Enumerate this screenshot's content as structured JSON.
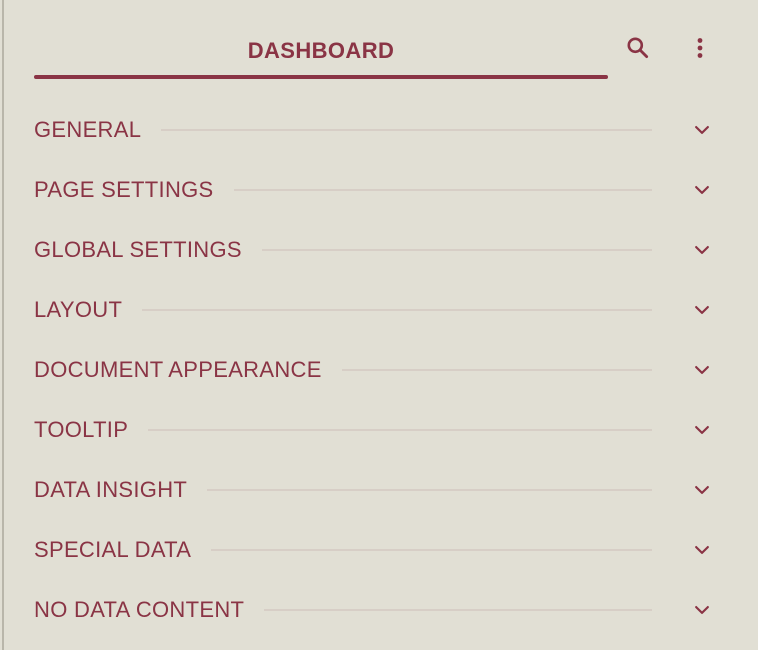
{
  "colors": {
    "background": "#e1dfd4",
    "accent": "#8a3445",
    "divider": "#d7cec6",
    "left_border": "#b9b6aa"
  },
  "header": {
    "tab_label": "DASHBOARD",
    "search_icon": "search-icon",
    "more_icon": "more-vertical-icon"
  },
  "sections": [
    {
      "label": "GENERAL",
      "icon": "chevron-down-icon"
    },
    {
      "label": "PAGE SETTINGS",
      "icon": "chevron-down-icon"
    },
    {
      "label": "GLOBAL SETTINGS",
      "icon": "chevron-down-icon"
    },
    {
      "label": "LAYOUT",
      "icon": "chevron-down-icon"
    },
    {
      "label": "DOCUMENT APPEARANCE",
      "icon": "chevron-down-icon"
    },
    {
      "label": "TOOLTIP",
      "icon": "chevron-down-icon"
    },
    {
      "label": "DATA INSIGHT",
      "icon": "chevron-down-icon"
    },
    {
      "label": "SPECIAL DATA",
      "icon": "chevron-down-icon"
    },
    {
      "label": "NO DATA CONTENT",
      "icon": "chevron-down-icon"
    }
  ]
}
